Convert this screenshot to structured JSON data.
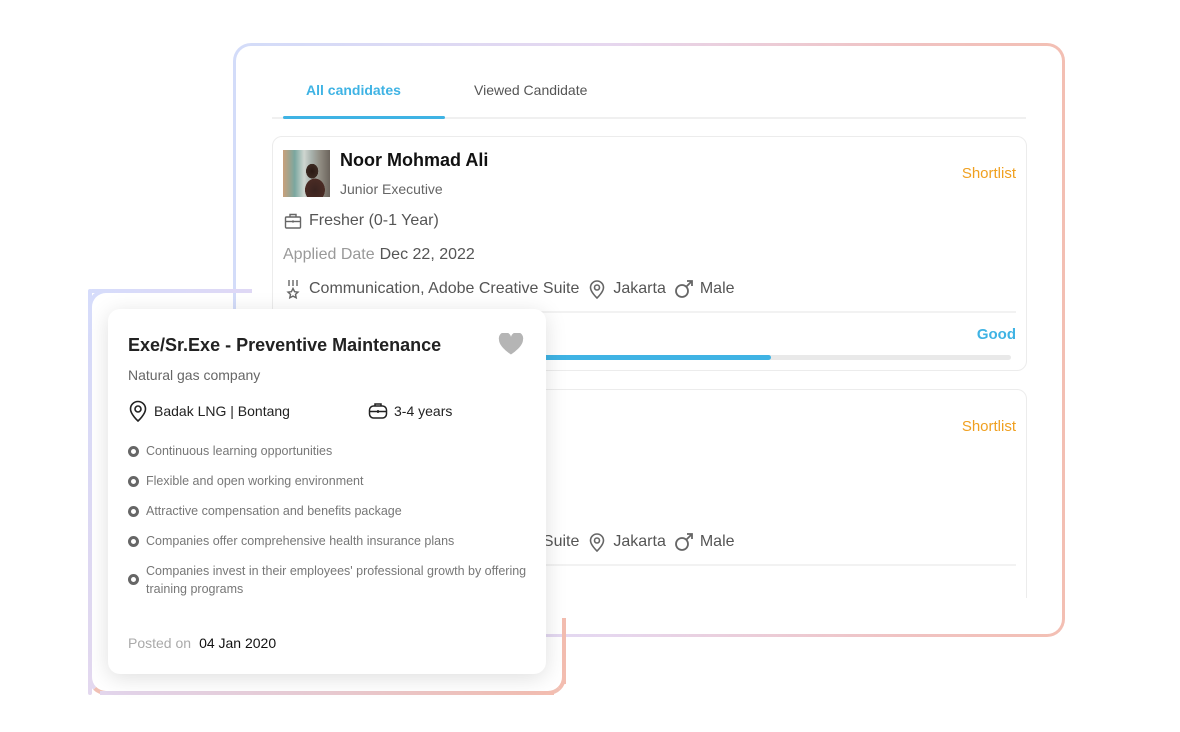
{
  "tabs": [
    {
      "label": "All candidates",
      "active": true
    },
    {
      "label": "Viewed Candidate",
      "active": false
    }
  ],
  "candidates": [
    {
      "name": "Noor Mohmad Ali",
      "role": "Junior Executive",
      "action": "Shortlist",
      "experience": "Fresher (0-1 Year)",
      "applied_label": "Applied Date",
      "applied_date": "Dec 22, 2022",
      "skills": "Communication, Adobe Creative Suite",
      "location": "Jakarta",
      "gender": "Male",
      "rating_label": "Good",
      "rating_progress_percent": 67
    },
    {
      "name": "",
      "role": "",
      "action": "Shortlist",
      "skills": "Communication, Adobe Creative Suite",
      "location": "Jakarta",
      "gender": "Male"
    }
  ],
  "job": {
    "title": "Exe/Sr.Exe - Preventive Maintenance",
    "company": "Natural gas company",
    "location": "Badak LNG |  Bontang",
    "experience": "3-4 years",
    "perks": [
      "Continuous learning opportunities",
      "Flexible and open working environment",
      "Attractive compensation and benefits package",
      "Companies offer comprehensive health insurance plans",
      "Companies invest in their employees' professional growth by offering training programs"
    ],
    "posted_label": "Posted on",
    "posted_date": "04 Jan 2020",
    "favorited": false
  },
  "colors": {
    "accent": "#3fb3e4",
    "shortlist": "#f0a020",
    "frame_start": "#d3dcf9",
    "frame_end": "#f3bfb3"
  }
}
